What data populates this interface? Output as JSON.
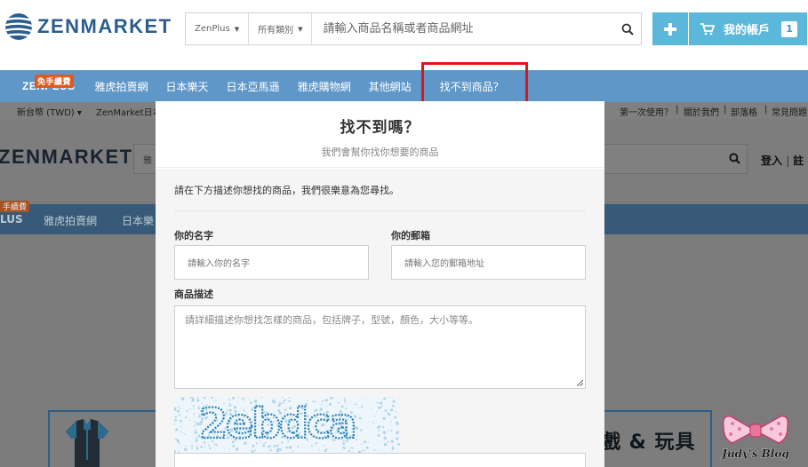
{
  "header": {
    "logo_text": "ZENMARKET",
    "search_dropdown_1": "ZenPlus",
    "search_dropdown_2": "所有類別",
    "search_placeholder": "請輸入商品名稱或者商品網址",
    "account_label": "我的帳戶",
    "account_count": "1"
  },
  "nav": {
    "zenplus_label": "ZENPLUS",
    "zenplus_badge": "免手續費",
    "items": [
      "雅虎拍賣網",
      "日本樂天",
      "日本亞馬遜",
      "雅虎購物網",
      "其他網站",
      "找不到商品？"
    ]
  },
  "background_page": {
    "currency": "新台幣 (TWD)",
    "zenmarket_short": "ZenMarket日本",
    "first_time": "第一次使用？",
    "about": "關於我們",
    "blog": "部落格",
    "faq": "常見問題",
    "logo_text": "ZENMARKET",
    "search_placeholder_partial": "雅",
    "login": "登入",
    "register_partial": "註",
    "nav_badge_partial": "手續費",
    "nav_zenplus_partial": "LUS",
    "nav_yahoo": "雅虎拍賣網",
    "nav_rakuten_partial": "日本樂",
    "category_text_partial": "戲 & 玩具",
    "watermark": "Judy's Blog"
  },
  "modal": {
    "title": "找不到嗎？",
    "subtitle": "我們會幫你找你想要的商品",
    "intro": "請在下方描述你想找的商品，我們很樂意為您尋找。",
    "name_label": "你的名字",
    "name_placeholder": "請輸入你的名字",
    "email_label": "你的郵箱",
    "email_placeholder": "請輸入您的郵箱地址",
    "desc_label": "商品描述",
    "desc_placeholder": "請詳細描述你想找怎樣的商品，包括牌子，型號，顏色，大小等等。",
    "captcha_text": "2ebdca"
  },
  "colors": {
    "brand_blue": "#2b5e8e",
    "nav_blue": "#5f97c8",
    "button_blue": "#5bb8da",
    "highlight_red": "#e01515",
    "badge_orange": "#e05a1f"
  }
}
